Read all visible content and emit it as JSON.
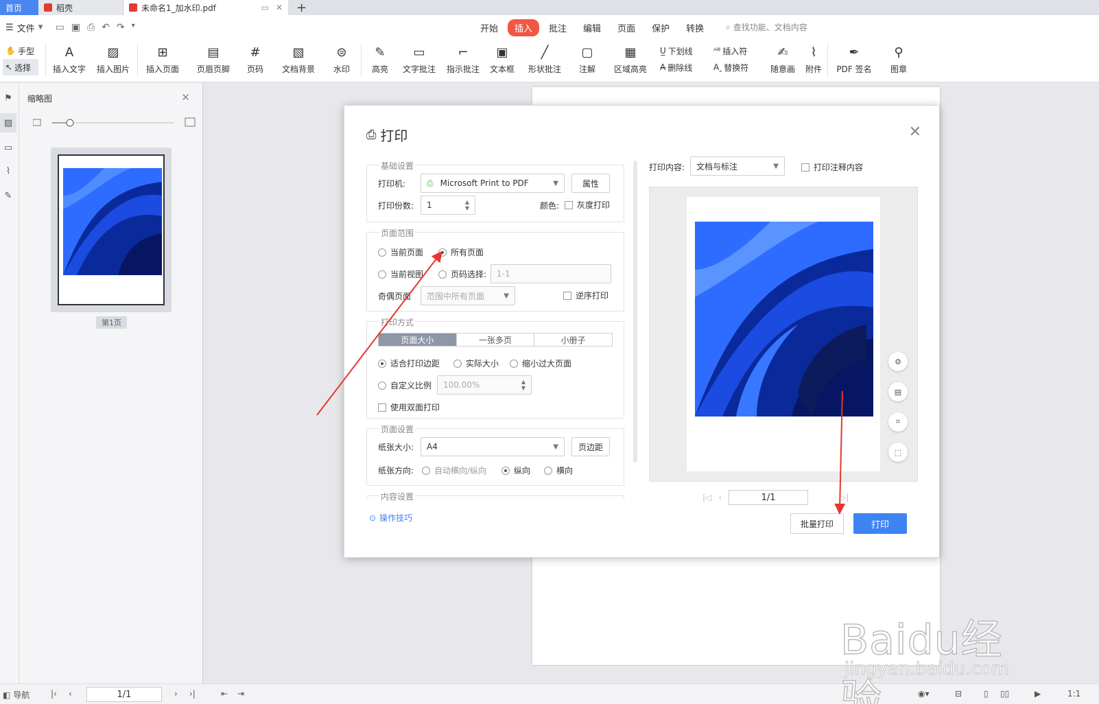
{
  "tabs": {
    "home": "首页",
    "daoke": "稻壳",
    "document": "未命名1_加水印.pdf",
    "new_tab": "+"
  },
  "menu": {
    "file": "文件",
    "tabs": [
      "开始",
      "插入",
      "批注",
      "编辑",
      "页面",
      "保护",
      "转换"
    ],
    "active_tab": "插入",
    "search_placeholder": "查找功能、文档内容"
  },
  "ribbon": {
    "hand_tool": "手型",
    "select_tool": "选择",
    "buttons": [
      "插入文字",
      "插入图片",
      "插入页面",
      "页眉页脚",
      "页码",
      "文档背景",
      "水印",
      "高亮",
      "文字批注",
      "指示批注",
      "文本框",
      "形状批注",
      "注解",
      "区域高亮"
    ],
    "underline": "下划线",
    "strikethrough": "删除线",
    "insert_symbol": "插入符",
    "replace_symbol": "替换符",
    "freehand": "随意画",
    "attachment": "附件",
    "pdf_sign": "PDF 签名",
    "stamp": "图章"
  },
  "thumbnail_panel": {
    "title": "缩略图",
    "page_label": "第1页"
  },
  "dialog": {
    "title": "打印",
    "basic": {
      "legend": "基础设置",
      "printer_label": "打印机:",
      "printer_value": "Microsoft Print to PDF",
      "properties_button": "属性",
      "copies_label": "打印份数:",
      "copies_value": "1",
      "color_label": "颜色:",
      "grayscale": "灰度打印"
    },
    "range": {
      "legend": "页面范围",
      "current_page": "当前页面",
      "all_pages": "所有页面",
      "current_view": "当前视图",
      "page_select": "页码选择:",
      "page_select_placeholder": "1-1",
      "odd_even_label": "奇偶页面",
      "odd_even_value": "范围中所有页面",
      "reverse": "逆序打印"
    },
    "mode": {
      "legend": "打印方式",
      "segments": [
        "页面大小",
        "一张多页",
        "小册子"
      ],
      "fit_margins": "适合打印边距",
      "actual_size": "实际大小",
      "shrink_oversize": "缩小过大页面",
      "custom_scale": "自定义比例",
      "custom_scale_value": "100.00%",
      "duplex": "使用双面打印"
    },
    "page_setup": {
      "legend": "页面设置",
      "paper_size_label": "纸张大小:",
      "paper_size_value": "A4",
      "margins_button": "页边距",
      "orientation_label": "纸张方向:",
      "auto": "自动横向/纵向",
      "portrait": "纵向",
      "landscape": "横向"
    },
    "content_setup_legend": "内容设置",
    "tips": "操作技巧",
    "print_content_label": "打印内容:",
    "print_content_value": "文档与标注",
    "print_comments": "打印注释内容",
    "pager_value": "1/1",
    "batch_print": "批量打印",
    "print": "打印"
  },
  "statusbar": {
    "nav": "导航",
    "page": "1/1"
  },
  "watermark": {
    "text": "Baidu经验",
    "sub": "jingyan.baidu.com"
  },
  "colors": {
    "accent": "#3d83f3",
    "active_tab": "#f15742",
    "arrow": "#e8352f"
  }
}
